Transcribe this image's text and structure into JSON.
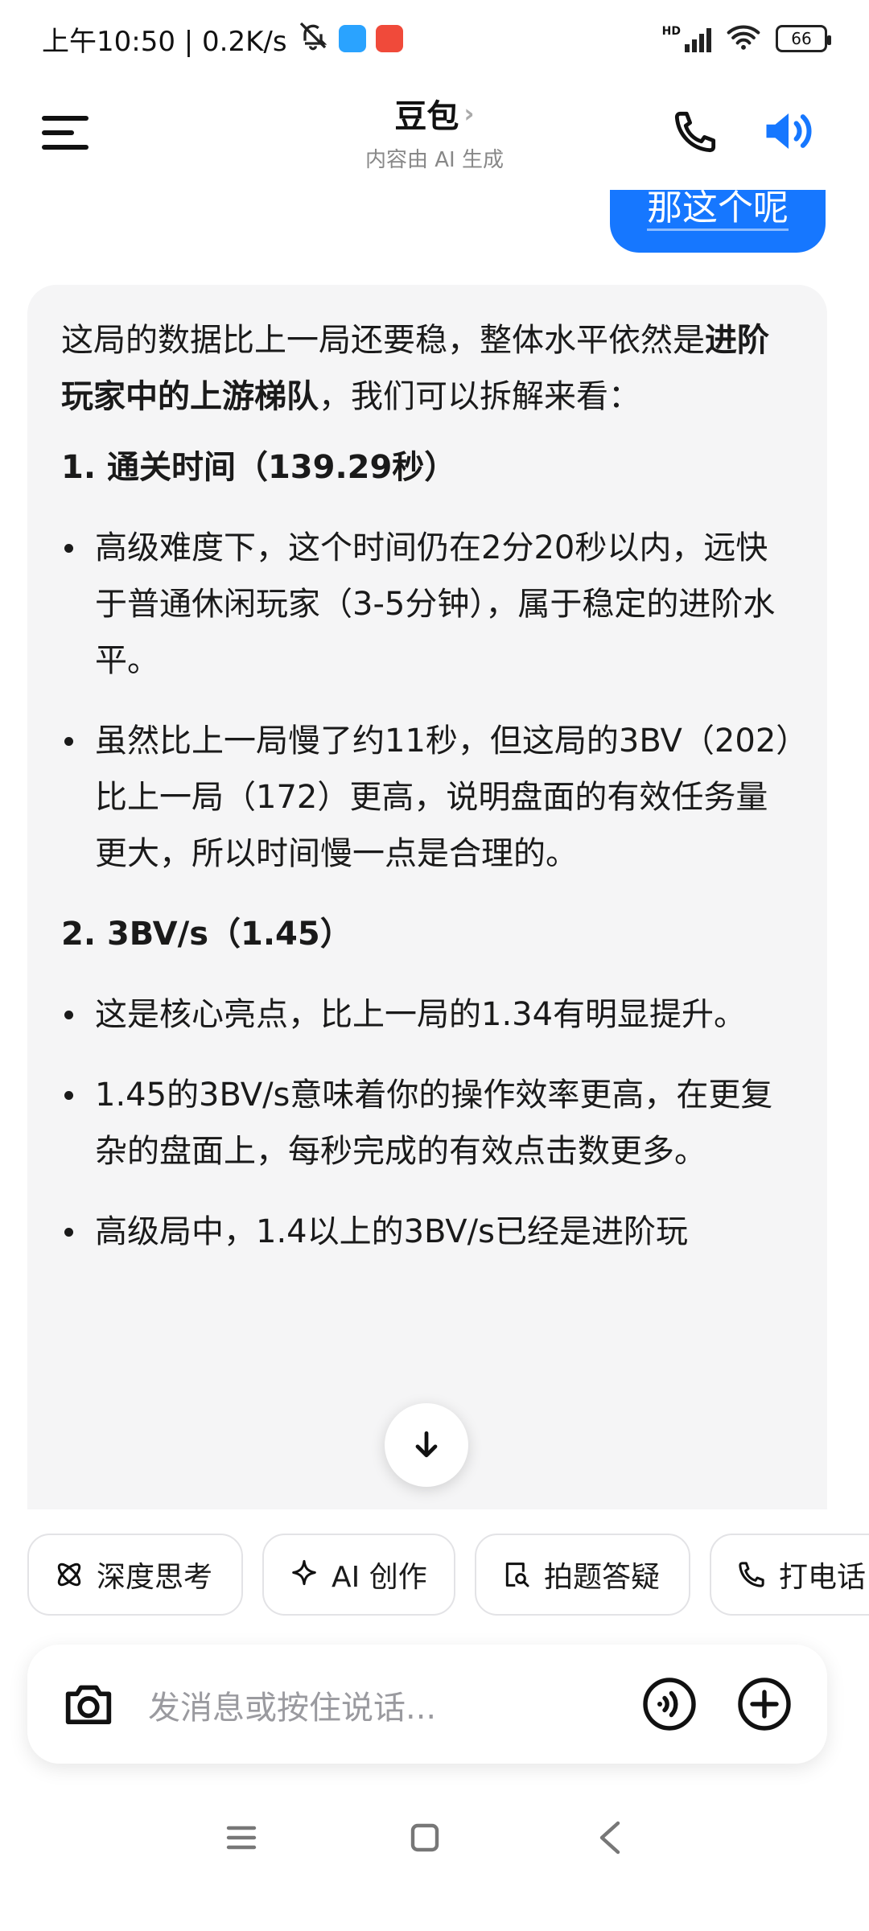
{
  "status_bar": {
    "time_speed": "上午10:50 | 0.2K/s",
    "network": "HD",
    "battery": "66",
    "icons": [
      "mute-icon",
      "app-icon-blue",
      "app-icon-red",
      "signal-icon",
      "wifi-icon",
      "battery-icon"
    ]
  },
  "header": {
    "title": "豆包",
    "chevron": "›",
    "subtitle": "内容由 AI 生成",
    "icons": [
      "menu-icon",
      "phone-icon",
      "speaker-icon"
    ]
  },
  "chat": {
    "user_message": "那这个呢",
    "ai": {
      "intro_start": "这局的数据比上一局还要稳，整体水平依然是",
      "intro_bold": "进阶玩家中的上游梯队",
      "intro_end": "，我们可以拆解来看：",
      "sections": [
        {
          "heading": "1. 通关时间（139.29秒）",
          "bullets": [
            "高级难度下，这个时间仍在2分20秒以内，远快于普通休闲玩家（3-5分钟），属于稳定的进阶水平。",
            "虽然比上一局慢了约11秒，但这局的3BV（202）比上一局（172）更高，说明盘面的有效任务量更大，所以时间慢一点是合理的。"
          ]
        },
        {
          "heading": "2. 3BV/s（1.45）",
          "bullets": [
            "这是核心亮点，比上一局的1.34有明显提升。",
            "1.45的3BV/s意味着你的操作效率更高，在更复杂的盘面上，每秒完成的有效点击数更多。",
            "高级局中，1.4以上的3BV/s已经是进阶玩"
          ]
        }
      ]
    }
  },
  "chips": [
    "深度思考",
    "AI 创作",
    "拍题答疑",
    "打电话"
  ],
  "input": {
    "placeholder": "发消息或按住说话..."
  },
  "colors": {
    "accent": "#1677ff",
    "card_bg": "#f5f5f6"
  }
}
